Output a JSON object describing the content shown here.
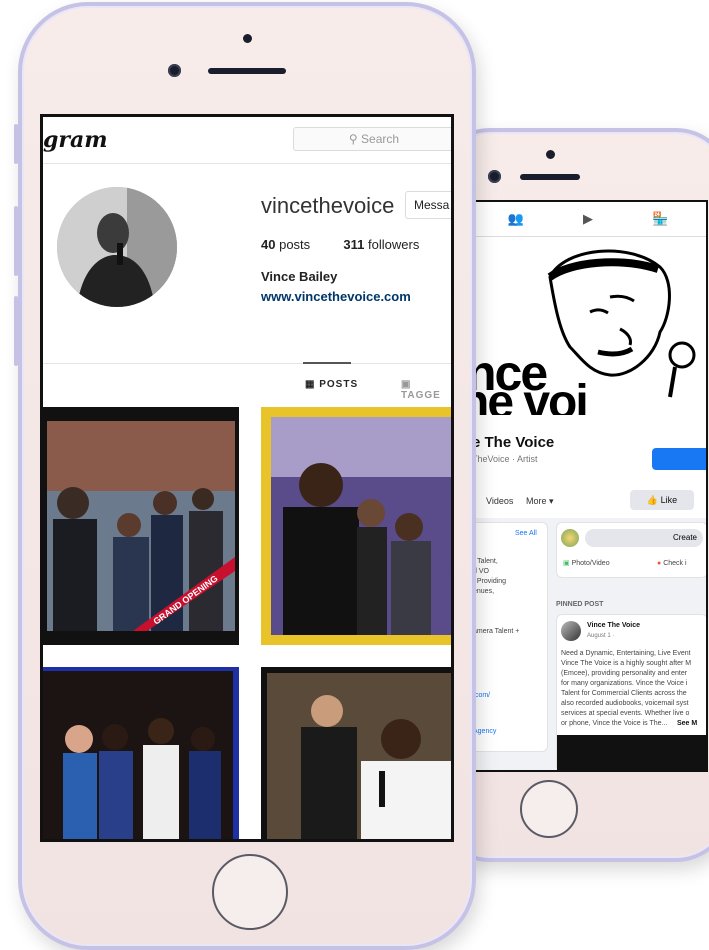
{
  "instagram": {
    "logo": "gram",
    "search_placeholder": "Search",
    "username": "vincethevoice",
    "message_button": "Messa",
    "posts_count": "40",
    "posts_label": "posts",
    "followers_count": "311",
    "followers_label": "followers",
    "full_name": "Vince Bailey",
    "website": "www.vincethevoice.com",
    "tab_posts": "POSTS",
    "tab_tagged": "TAGGE",
    "photo_banner_text": "GRAND OPENING"
  },
  "facebook": {
    "cover_word_1": "nce",
    "cover_word_2": "he voi",
    "page_name": "e The Voice",
    "page_sub": "TheVoice · Artist",
    "tab_videos": "Videos",
    "tab_more": "More ▾",
    "like_button": "Like",
    "see_all": "See All",
    "create": "Create",
    "photo_video": "Photo/Video",
    "check_in": "Check i",
    "intro_lines": [
      "r Talent,",
      "d VO",
      ", Providing",
      "enues,",
      ",",
      "",
      "amera Talent +",
      "",
      "",
      "",
      ".com/",
      "",
      "Agency"
    ],
    "pinned_post_label": "PINNED POST",
    "post_author": "Vince The Voice",
    "post_date": "August 1 · ",
    "post_text": [
      "Need a Dynamic, Entertaining, Live Event",
      "Vince The Voice is a highly sought after M",
      "(Emcee), providing personality and enter",
      "for many organizations. Vince the Voice i",
      "Talent for Commercial Clients across the",
      "also recorded audiobooks, voicemail syst",
      "services at special events. Whether live o",
      "or phone, Vince the Voice is The..."
    ],
    "see_more": "See M"
  },
  "colors": {
    "phone_body": "#f3e6e4",
    "phone_frame": "#c6c2e6",
    "fb_blue": "#1877f2",
    "ig_link": "#00376b",
    "tile_frame_yellow": "#e8c42a",
    "tile_frame_blue": "#1f2fa6",
    "banner_red": "#c8102e"
  }
}
